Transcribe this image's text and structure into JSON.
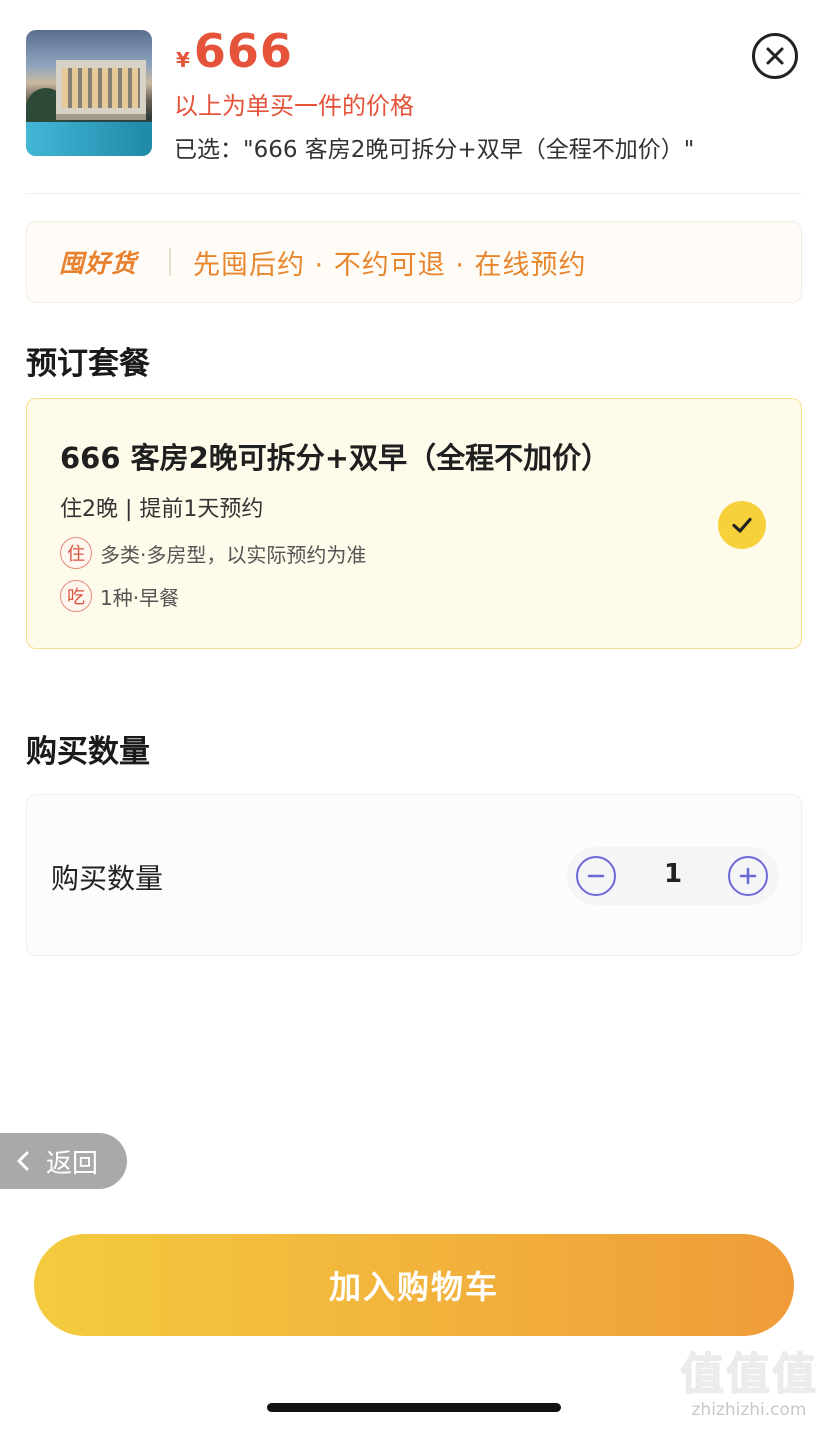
{
  "header": {
    "currency": "¥",
    "price": "666",
    "price_note": "以上为单买一件的价格",
    "selected": "已选：\"666 客房2晚可拆分+双早（全程不加价）\""
  },
  "promo": {
    "logo": "囤好货",
    "text": "先囤后约 · 不约可退 · 在线预约"
  },
  "package_section": {
    "title": "预订套餐",
    "card": {
      "title": "666 客房2晚可拆分+双早（全程不加价）",
      "subtitle": "住2晚 | 提前1天预约",
      "lines": [
        {
          "tag": "住",
          "text": "多类·多房型，以实际预约为准"
        },
        {
          "tag": "吃",
          "text": "1种·早餐"
        }
      ],
      "selected": true
    }
  },
  "quantity_section": {
    "title": "购买数量",
    "label": "购买数量",
    "value": "1"
  },
  "back_label": "返回",
  "cta_label": "加入购物车",
  "watermark": {
    "glyphs": "值值值",
    "site": "zhizhizhi.com"
  },
  "colors": {
    "price": "#e5533a",
    "promo": "#e8862e",
    "accent_yellow": "#f6d13c",
    "stepper": "#6b6bd8"
  },
  "icons": {
    "close": "close-icon",
    "check": "check-icon",
    "minus": "minus-circle-icon",
    "plus": "plus-circle-icon",
    "back": "chevron-left-icon"
  }
}
